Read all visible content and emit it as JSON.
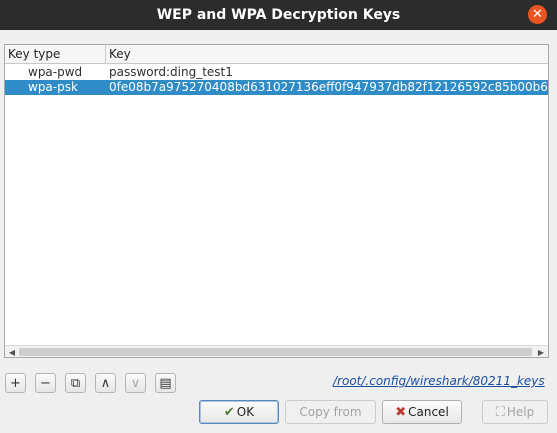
{
  "window": {
    "title": "WEP and WPA Decryption Keys",
    "close_glyph": "✕"
  },
  "table": {
    "headers": [
      "Key type",
      "Key"
    ],
    "rows": [
      {
        "type": "wpa-pwd",
        "key": "password:ding_test1",
        "selected": false
      },
      {
        "type": "wpa-psk",
        "key": "0fe08b7a975270408bd631027136eff0f947937db82f12126592c85b00b6",
        "selected": true
      }
    ]
  },
  "toolbar": {
    "add_glyph": "+",
    "remove_glyph": "−",
    "copy_glyph": "⧉",
    "up_glyph": "∧",
    "down_glyph": "∨",
    "clear_glyph": "▤",
    "path": "/root/.config/wireshark/80211_keys"
  },
  "buttons": {
    "ok": "OK",
    "copy_from": "Copy from",
    "cancel": "Cancel",
    "help": "Help"
  },
  "icons": {
    "ok": "ok-icon",
    "cancel": "cancel-icon",
    "help": "help-icon"
  },
  "colors": {
    "selection": "#308cc6",
    "titlebar": "#2c2c2c",
    "close": "#e95420",
    "link": "#1a4fa0"
  }
}
